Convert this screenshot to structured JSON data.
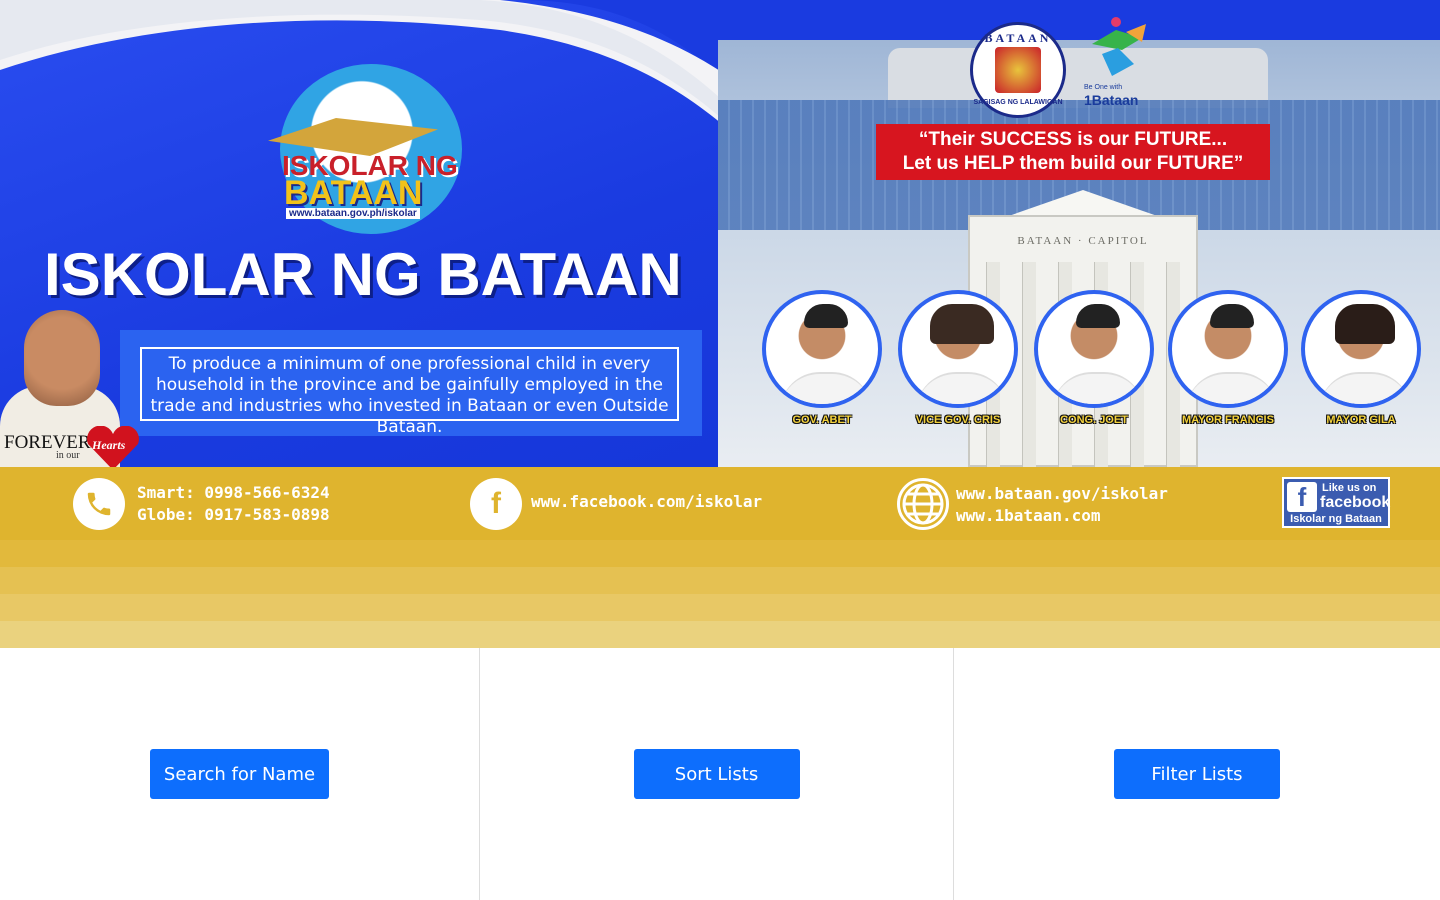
{
  "banner": {
    "logo": {
      "line1": "ISKOLAR NG",
      "line2": "BATAAN",
      "url": "www.bataan.gov.ph/iskolar"
    },
    "title": "ISKOLAR NG BATAAN",
    "mission": "To produce a minimum of one professional child in every household in the province and be gainfully employed in the trade and industries who invested in Bataan or even Outside Bataan.",
    "quote_line1": "“Their SUCCESS is our FUTURE...",
    "quote_line2": "Let us HELP them build our FUTURE”",
    "seal": {
      "top": "BATAAN",
      "bottom": "SAGISAG NG LALAWIGAN"
    },
    "onebataan": {
      "tagline": "Be One with",
      "brand": "1Bataan"
    },
    "building_label": "BATAAN · CAPITOL",
    "governor_tagline": {
      "forever": "FOREVER",
      "in_our": "in our",
      "hearts": "Hearts"
    },
    "officials": [
      {
        "name": "GOV. ABET"
      },
      {
        "name": "VICE GOV. CRIS"
      },
      {
        "name": "CONG. JOET"
      },
      {
        "name": "MAYOR FRANCIS"
      },
      {
        "name": "MAYOR GILA"
      }
    ]
  },
  "contacts": {
    "smart": "Smart: 0998-566-6324",
    "globe": "Globe: 0917-583-0898",
    "facebook": "www.facebook.com/iskolar",
    "web1": "www.bataan.gov/iskolar",
    "web2": "www.1bataan.com",
    "fb_like": {
      "line1": "Like us on",
      "line2": "facebook",
      "line3": "Iskolar ng Bataan"
    }
  },
  "actions": {
    "search_label": "Search for Name",
    "sort_label": "Sort Lists",
    "filter_label": "Filter Lists"
  },
  "colors": {
    "banner_blue": "#1a3be0",
    "gold": "#dfb42e",
    "button": "#0d6efd",
    "quote_red": "#d7151f"
  },
  "icons": [
    "phone-icon",
    "facebook-icon",
    "globe-icon"
  ]
}
